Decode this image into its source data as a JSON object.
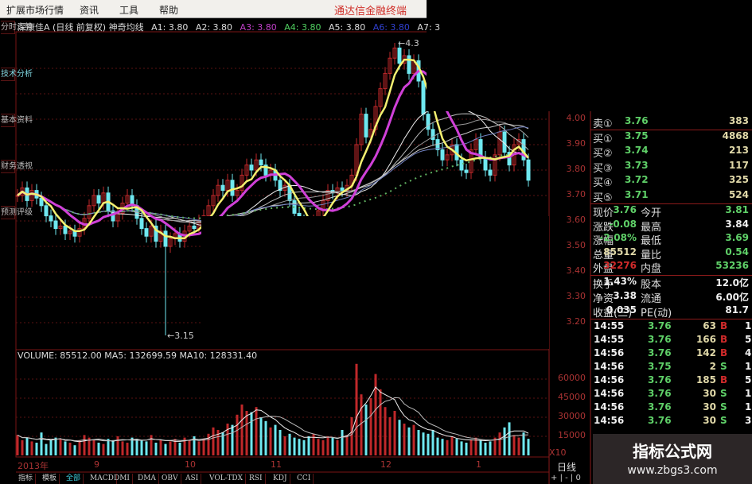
{
  "menu": {
    "items": [
      "扩展市场行情",
      "资讯",
      "工具",
      "帮助"
    ],
    "brand": "通达信金融终端"
  },
  "sidebar": {
    "tabs": [
      "分时走势",
      "技术分析",
      "基本资料",
      "财务透视",
      "预测评级"
    ],
    "active": 1
  },
  "title": {
    "stock": "深康佳A (日线 前复权) 神奇均线",
    "a1": "A1: 3.80",
    "a2": "A2: 3.80",
    "a3": "A3: 3.80",
    "a4": "A4: 3.80",
    "a5": "A5: 3.80",
    "a6": "A6: 3.80",
    "a7": "A7: 3"
  },
  "colors": {
    "up": "#c0282a",
    "down": "#6fe8f0",
    "ma5": "#f4f070",
    "ma10": "#d040d8",
    "ma_long": "#5fb060",
    "grid": "#5a1212"
  },
  "price_axis": [
    "4.00",
    "3.90",
    "3.80",
    "3.70",
    "3.60",
    "3.50",
    "3.40",
    "3.30",
    "3.20"
  ],
  "volume_axis": [
    "60000",
    "45000",
    "30000",
    "15000"
  ],
  "volume_scale_label": "X10",
  "period_label": "日线",
  "zoom_buttons": [
    "+",
    "-",
    "0"
  ],
  "markers": {
    "high": {
      "index": 79,
      "value": 4.3,
      "label": "4.3"
    },
    "low": {
      "index": 31,
      "value": 3.15,
      "label": "3.15"
    }
  },
  "chart_data": {
    "type": "candlestick",
    "closes": [
      3.7,
      3.73,
      3.68,
      3.72,
      3.69,
      3.66,
      3.62,
      3.6,
      3.57,
      3.58,
      3.55,
      3.56,
      3.54,
      3.57,
      3.61,
      3.66,
      3.7,
      3.67,
      3.71,
      3.64,
      3.6,
      3.63,
      3.67,
      3.7,
      3.66,
      3.61,
      3.57,
      3.54,
      3.58,
      3.52,
      3.56,
      3.5,
      3.53,
      3.55,
      3.52,
      3.56,
      3.58,
      3.57,
      3.6,
      3.62,
      3.66,
      3.7,
      3.74,
      3.72,
      3.76,
      3.7,
      3.72,
      3.78,
      3.82,
      3.8,
      3.84,
      3.82,
      3.78,
      3.8,
      3.76,
      3.72,
      3.74,
      3.68,
      3.63,
      3.6,
      3.58,
      3.56,
      3.6,
      3.64,
      3.68,
      3.72,
      3.71,
      3.73,
      3.72,
      3.74,
      3.78,
      3.9,
      4.02,
      3.93,
      3.96,
      4.05,
      4.12,
      4.18,
      4.24,
      4.28,
      4.22,
      4.25,
      4.18,
      4.23,
      4.15,
      4.02,
      3.96,
      3.92,
      3.88,
      3.84,
      3.86,
      3.9,
      3.84,
      3.8,
      3.79,
      3.88,
      3.92,
      3.85,
      3.8,
      3.78,
      3.86,
      3.95,
      3.87,
      3.82,
      3.9,
      3.92,
      3.84,
      3.76
    ],
    "volumes": [
      16000,
      12000,
      14000,
      11000,
      10000,
      18000,
      9000,
      12000,
      14000,
      13000,
      11000,
      10000,
      8000,
      12000,
      16000,
      14000,
      12000,
      10000,
      9000,
      13000,
      12000,
      15000,
      11000,
      10000,
      14000,
      13000,
      12000,
      11000,
      16000,
      10000,
      12000,
      9000,
      11000,
      13000,
      10000,
      14000,
      12000,
      15000,
      11000,
      13000,
      17000,
      22000,
      20000,
      18000,
      25000,
      24000,
      32000,
      40000,
      35000,
      34000,
      38000,
      30000,
      27000,
      22000,
      24000,
      20000,
      15000,
      17000,
      14000,
      13000,
      12000,
      15000,
      17000,
      13000,
      12000,
      15000,
      14000,
      12000,
      20000,
      16000,
      30000,
      72000,
      48000,
      40000,
      45000,
      64000,
      52000,
      38000,
      30000,
      35000,
      28000,
      25000,
      22000,
      24000,
      20000,
      18000,
      17000,
      20000,
      14000,
      13000,
      12000,
      15000,
      13000,
      11000,
      10000,
      12000,
      14000,
      12000,
      10000,
      11000,
      14000,
      18000,
      22000,
      26000,
      16000,
      14000,
      18000,
      13000
    ],
    "xlabels": [
      {
        "index": 0,
        "label": "2013年"
      },
      {
        "index": 16,
        "label": "9"
      },
      {
        "index": 35,
        "label": "10"
      },
      {
        "index": 53,
        "label": "11"
      },
      {
        "index": 76,
        "label": "12"
      },
      {
        "index": 96,
        "label": "1"
      }
    ],
    "ylim": [
      3.1,
      4.35
    ]
  },
  "volume_header": "VOLUME: 85512.00  MA5: 132699.59  MA10: 128331.40",
  "quote": {
    "sell": [
      {
        "label": "卖①",
        "price": "3.76",
        "vol": "383"
      }
    ],
    "buy": [
      {
        "label": "买①",
        "price": "3.75",
        "vol": "4868"
      },
      {
        "label": "买②",
        "price": "3.74",
        "vol": "213"
      },
      {
        "label": "买③",
        "price": "3.73",
        "vol": "117"
      },
      {
        "label": "买④",
        "price": "3.72",
        "vol": "325"
      },
      {
        "label": "买⑤",
        "price": "3.71",
        "vol": "524"
      }
    ],
    "stats": [
      {
        "l1": "现价",
        "v1": "3.76",
        "l2": "今开",
        "v2": "3.81"
      },
      {
        "l1": "涨跌",
        "v1": "-0.08",
        "l2": "最高",
        "v2": "3.84"
      },
      {
        "l1": "涨幅",
        "v1": "-2.08%",
        "l2": "最低",
        "v2": "3.69"
      },
      {
        "l1": "总量",
        "v1": "85512",
        "l2": "量比",
        "v2": "0.54"
      },
      {
        "l1": "外盘",
        "v1": "32276",
        "l2": "内盘",
        "v2": "53236"
      }
    ],
    "info": [
      {
        "l1": "换手",
        "v1": "1.43%",
        "l2": "股本",
        "v2": "12.0亿"
      },
      {
        "l1": "净资",
        "v1": "3.38",
        "l2": "流通",
        "v2": "6.00亿"
      },
      {
        "l1": "收益(三)",
        "v1": "0.035",
        "l2": "PE(动)",
        "v2": "81.7"
      }
    ]
  },
  "trades": [
    {
      "time": "14:55",
      "price": "3.76",
      "vol": "63",
      "side": "B",
      "n": "1"
    },
    {
      "time": "14:55",
      "price": "3.76",
      "vol": "166",
      "side": "B",
      "n": "5"
    },
    {
      "time": "14:56",
      "price": "3.76",
      "vol": "142",
      "side": "B",
      "n": "4"
    },
    {
      "time": "14:56",
      "price": "3.75",
      "vol": "2",
      "side": "S",
      "n": "1"
    },
    {
      "time": "14:56",
      "price": "3.76",
      "vol": "185",
      "side": "B",
      "n": "5"
    },
    {
      "time": "14:56",
      "price": "3.76",
      "vol": "30",
      "side": "S",
      "n": "1"
    },
    {
      "time": "14:56",
      "price": "3.76",
      "vol": "30",
      "side": "S",
      "n": "1"
    },
    {
      "time": "14:56",
      "price": "3.76",
      "vol": "30",
      "side": "S",
      "n": "3"
    }
  ],
  "bottom_tabs": [
    "指标",
    "模板",
    "全部",
    "MACD",
    "DMI",
    "DMA",
    "OBV",
    "ASI",
    "VOL-TDX",
    "RSI",
    "KDJ",
    "CCI"
  ],
  "watermark": {
    "title": "指标公式网",
    "url": "www.zbgs3.com"
  }
}
